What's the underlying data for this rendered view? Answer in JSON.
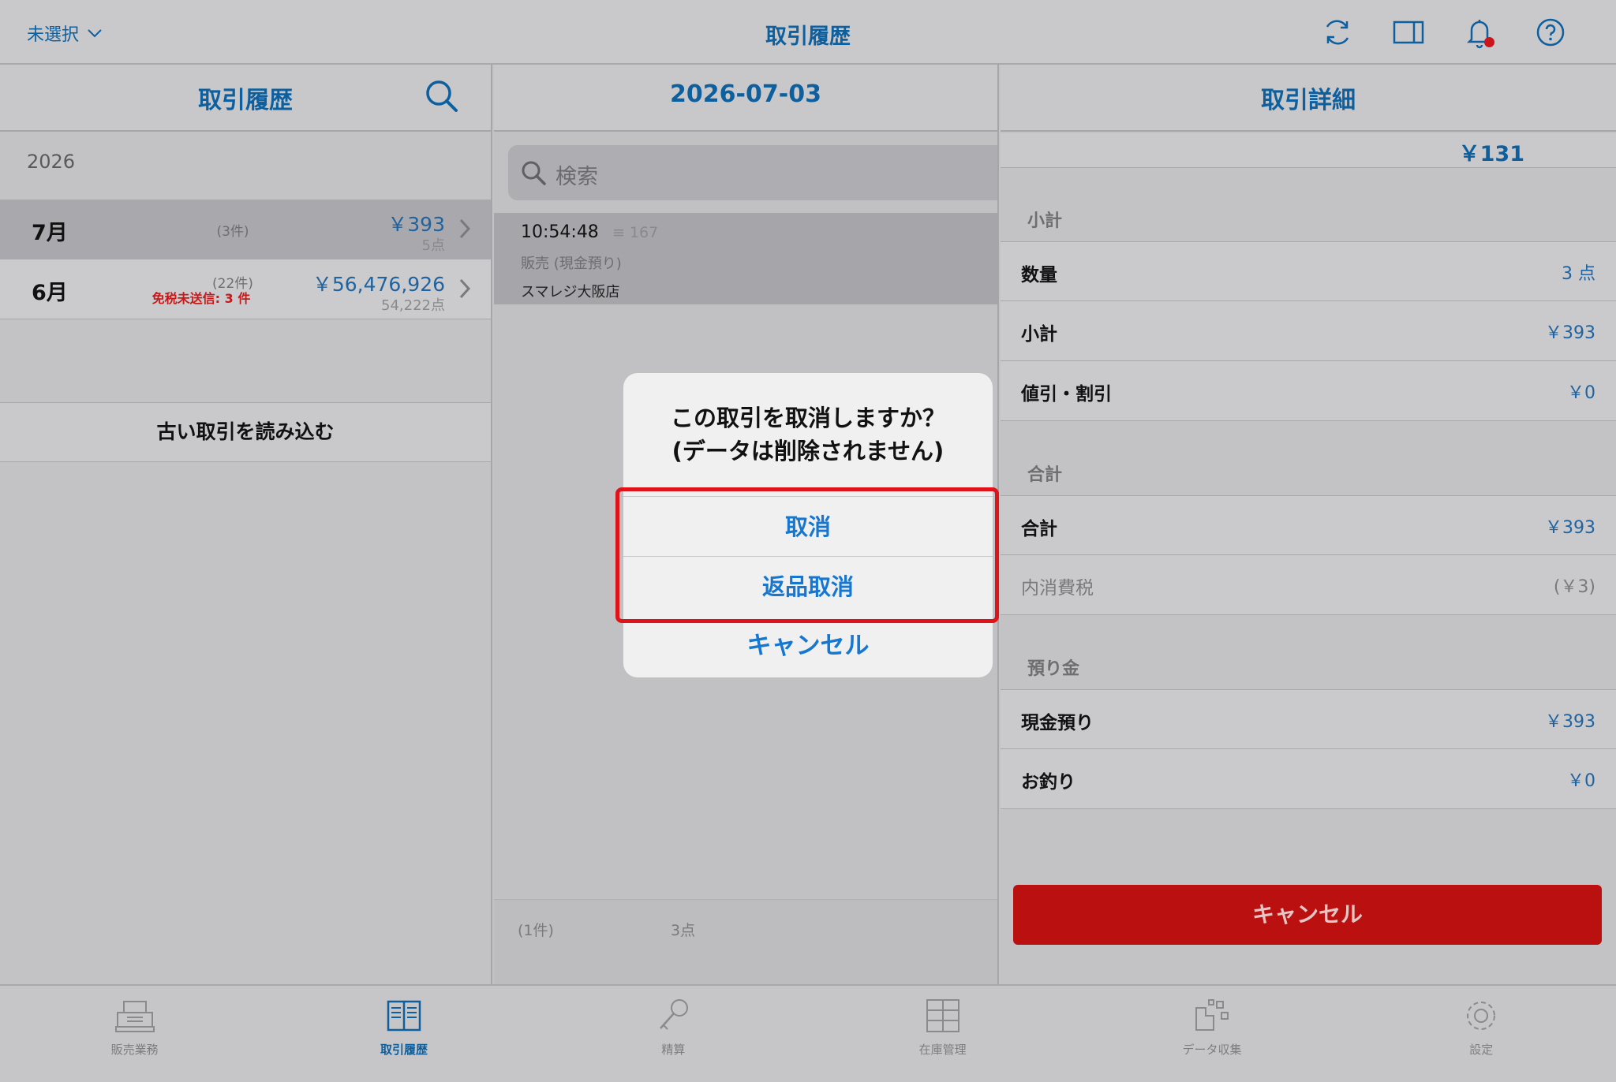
{
  "topbar": {
    "store_selector": "未選択",
    "title": "取引履歴",
    "icons": [
      "sync-icon",
      "split-view-icon",
      "bell-icon",
      "help-icon"
    ]
  },
  "left": {
    "title": "取引履歴",
    "year": "2026",
    "months": [
      {
        "name": "7月",
        "count": "(3件)",
        "warning": "",
        "amount": "￥393",
        "points": "5点"
      },
      {
        "name": "6月",
        "count": "(22件)",
        "warning": "免税未送信: 3 件",
        "amount": "￥56,476,926",
        "points": "54,222点"
      }
    ],
    "load_older": "古い取引を読み込む"
  },
  "middle": {
    "title": "2026-07-03",
    "search_placeholder": "検索",
    "transaction": {
      "time": "10:54:48",
      "number": "≡ 167",
      "type": "販売 (現金預り)",
      "store": "スマレジ大阪店"
    },
    "footer_count": "(1件)",
    "footer_points": "3点"
  },
  "right": {
    "title": "取引詳細",
    "top_amount": "￥131",
    "subtotal_section": "小計",
    "quantity_label": "数量",
    "quantity_value": "3 点",
    "subtotal_label": "小計",
    "subtotal_value": "￥393",
    "discount_label": "値引・割引",
    "discount_value": "￥0",
    "total_section": "合計",
    "total_label": "合計",
    "total_value": "￥393",
    "tax_label": "内消費税",
    "tax_value": "(￥3)",
    "deposit_section": "預り金",
    "cash_label": "現金預り",
    "cash_value": "￥393",
    "change_label": "お釣り",
    "change_value": "￥0",
    "cancel_button": "キャンセル"
  },
  "dialog": {
    "message_line1": "この取引を取消しますか？",
    "message_line2": "(データは削除されません)",
    "void_button": "取消",
    "return_void_button": "返品取消",
    "cancel_button": "キャンセル"
  },
  "tabs": [
    {
      "label": "販売業務",
      "icon": "register-icon",
      "active": false
    },
    {
      "label": "取引履歴",
      "icon": "book-icon",
      "active": true
    },
    {
      "label": "精算",
      "icon": "key-icon",
      "active": false
    },
    {
      "label": "在庫管理",
      "icon": "cabinet-icon",
      "active": false
    },
    {
      "label": "データ収集",
      "icon": "data-collection-icon",
      "active": false
    },
    {
      "label": "設定",
      "icon": "gear-icon",
      "active": false
    }
  ],
  "colors": {
    "accent": "#0d5f9e",
    "button_blue": "#1677d0",
    "danger": "#ba1010",
    "highlight": "#e0131b",
    "warning_text": "#c61a1a"
  }
}
